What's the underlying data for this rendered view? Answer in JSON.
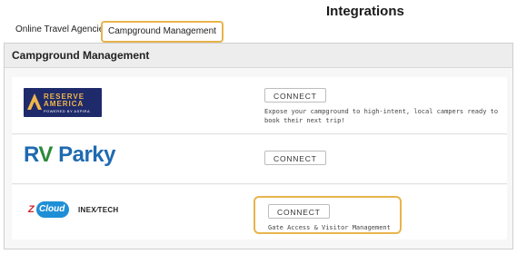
{
  "header": {
    "title": "Integrations"
  },
  "tabs": [
    {
      "label": "Online Travel Agencies",
      "active": false
    },
    {
      "label": "Campground Management",
      "active": true
    }
  ],
  "panel": {
    "title": "Campground Management",
    "integrations": [
      {
        "logo_icon": "reserve-america-logo",
        "logo_lines": [
          "RESERVE",
          "AMERICA",
          "POWERED BY ASPIRA"
        ],
        "button_label": "CONNECT",
        "description": "Expose your campground to high-intent, local campers ready to book their next trip!"
      },
      {
        "logo_icon": "rv-parky-logo",
        "logo_text_rv": "R",
        "logo_text_v": "V",
        "logo_text_parky": " Parky",
        "button_label": "CONNECT",
        "description": ""
      },
      {
        "logo_icon": "zcloud-inextech-logo",
        "logo_text_z": "Z",
        "logo_text_cloud": "Cloud",
        "logo_text_inex": "INEX∕TECH",
        "button_label": "CONNECT",
        "description": "Gate Access & Visitor Management"
      }
    ]
  },
  "colors": {
    "highlight": "#e8b44c",
    "reserve_america_bg": "#1f2a6b",
    "reserve_america_text": "#f0b64a",
    "rv_parky_blue": "#1f6ab0",
    "rv_parky_green": "#2a8a3a",
    "zcloud_blue": "#1e8fd6",
    "zcloud_red": "#d2232a"
  }
}
